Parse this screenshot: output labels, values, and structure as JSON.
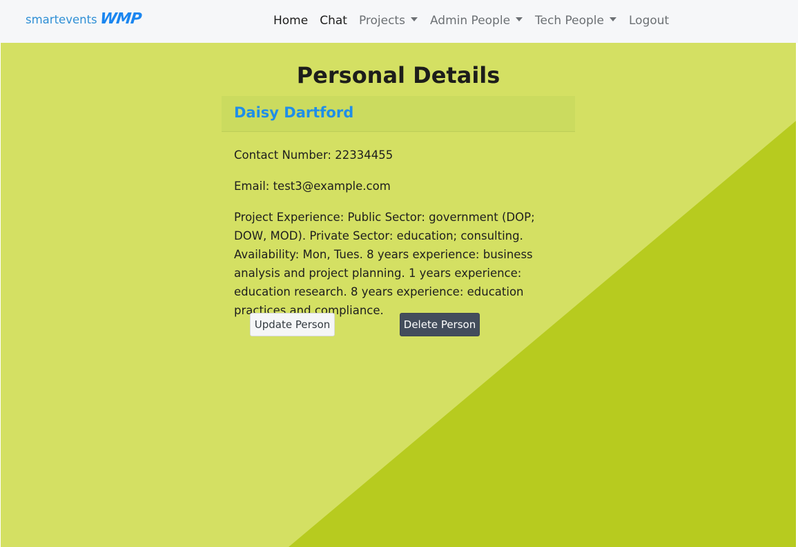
{
  "brand": {
    "smart": "smart",
    "events": "events",
    "logo": "WMP"
  },
  "nav": {
    "home": "Home",
    "chat": "Chat",
    "projects": "Projects",
    "admin_people": "Admin People",
    "tech_people": "Tech People",
    "logout": "Logout"
  },
  "page": {
    "title": "Personal Details"
  },
  "person": {
    "name": "Daisy Dartford",
    "contact": "Contact Number: 22334455",
    "email": "Email: test3@example.com",
    "experience": "Project Experience: Public Sector: government (DOP; DOW, MOD). Private Sector: education; consulting. Availability: Mon, Tues. 8 years experience: business analysis and project planning. 1 years experience: education research. 8 years experience: education practices and compliance."
  },
  "actions": {
    "update": "Update Person",
    "delete": "Delete Person"
  },
  "colors": {
    "background_light": "#d4e063",
    "background_dark": "#b7cb1f",
    "card_header": "#cbdb5f",
    "name": "#1f8ee8",
    "delete_button": "#434d5c"
  }
}
